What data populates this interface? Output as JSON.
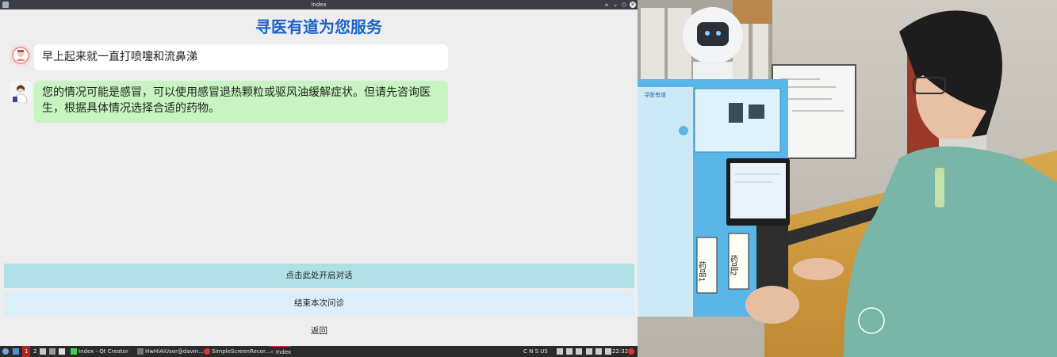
{
  "window": {
    "title": "Index"
  },
  "app": {
    "page_title": "寻医有道为您服务"
  },
  "chat": {
    "user_message": "早上起来就一直打喷嚏和流鼻涕",
    "bot_message": "您的情况可能是感冒，可以使用感冒退热颗粒或驱风油缓解症状。但请先咨询医生，根据具体情况选择合适的药物。"
  },
  "buttons": {
    "start_dialog": "点击此处开启对话",
    "end_consult": "结束本次问诊",
    "back": "返回"
  },
  "taskbar": {
    "workspace_1": "1",
    "workspace_2": "2",
    "task_qtcreator": "Index - Qt Creator",
    "task_terminal": "HwHiAiUser@davin...",
    "task_recorder": "SimpleScreenRecor...",
    "task_index": "Index",
    "locale_indicator": "C N S  US",
    "clock": "22:32"
  },
  "photo": {
    "kiosk_header": "寻医有道",
    "drawer_label_1": "药品1",
    "drawer_label_2": "药品2"
  },
  "colors": {
    "title_blue": "#1a63c4",
    "user_bubble": "#ffffff",
    "bot_bubble": "#c7f4c1",
    "start_button": "#b0e0e6",
    "end_button": "#ddeefb"
  }
}
